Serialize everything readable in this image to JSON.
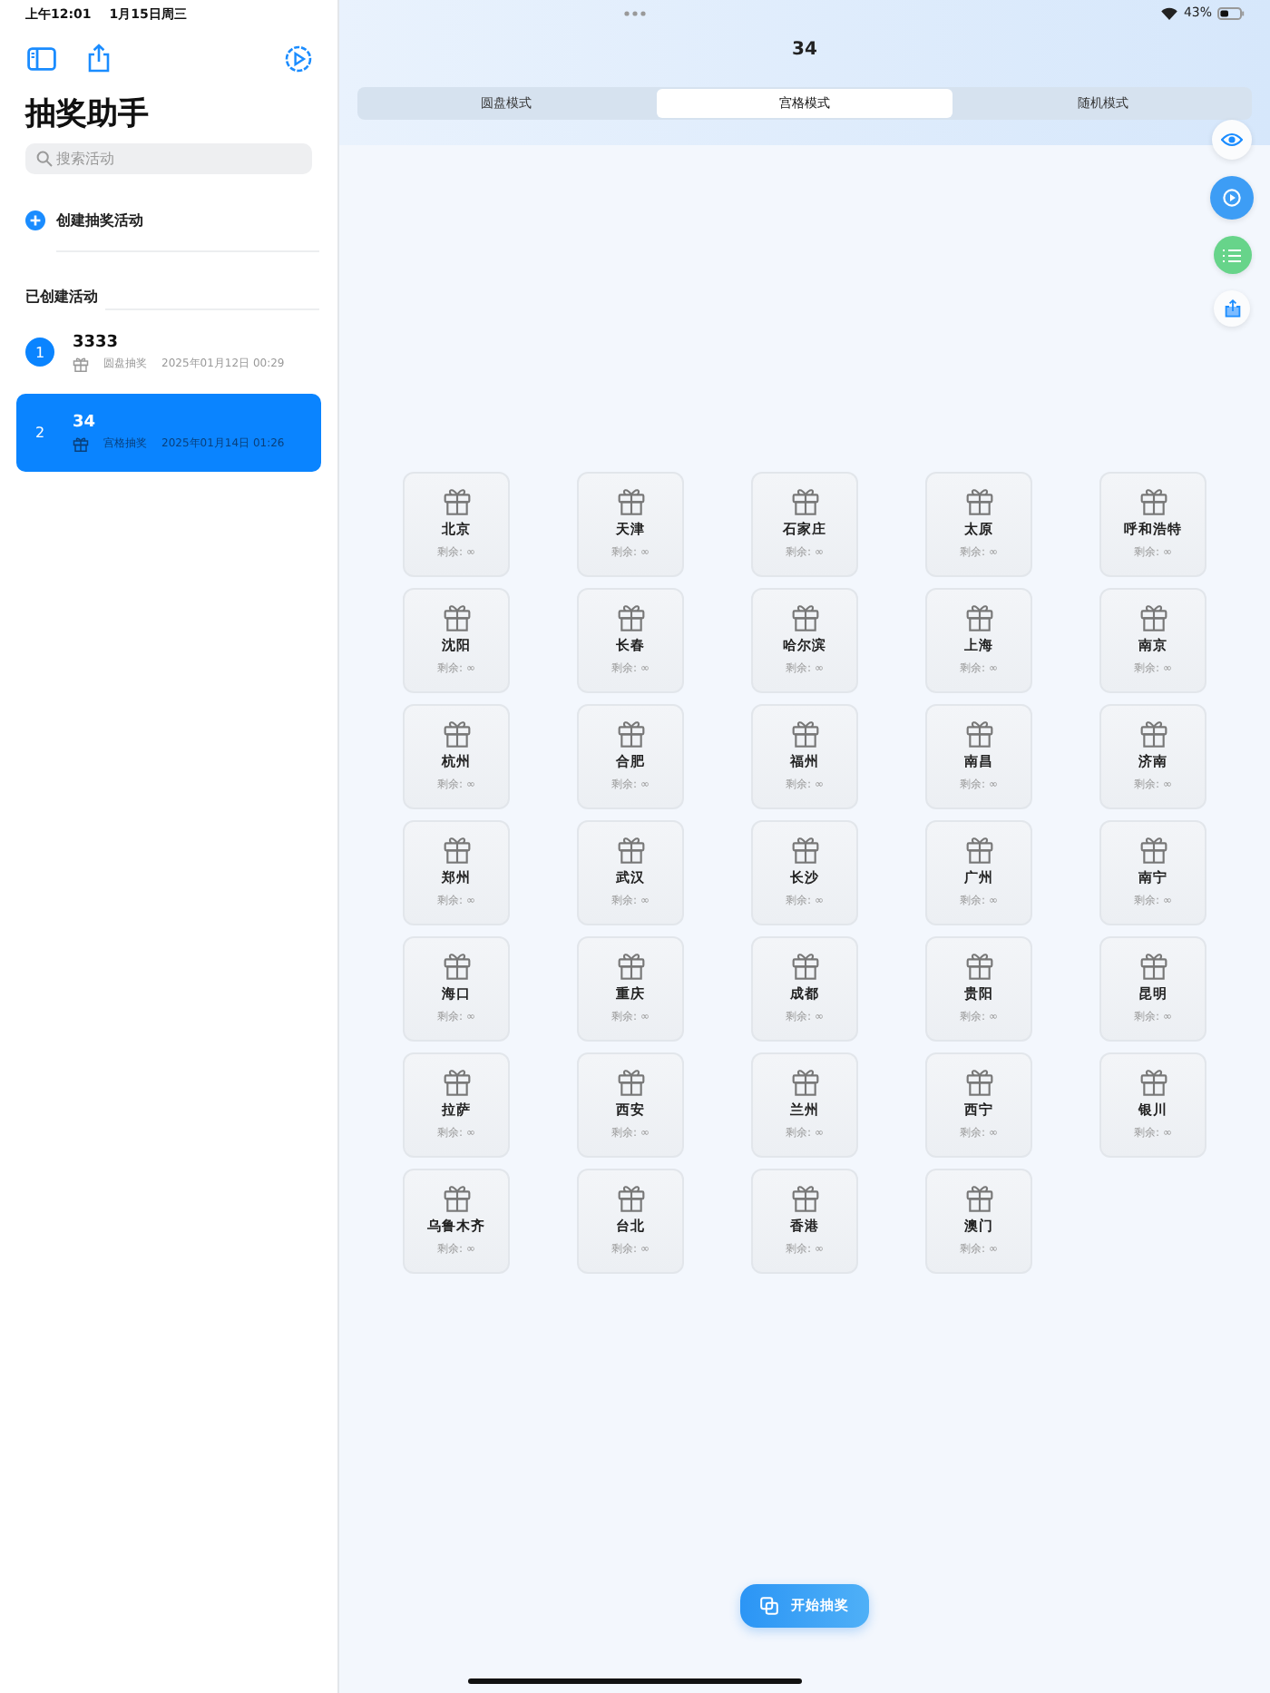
{
  "status_bar": {
    "time": "上午12:01",
    "date": "1月15日周三",
    "battery_text": "43%"
  },
  "sidebar": {
    "title": "抽奖助手",
    "search": {
      "placeholder": "搜索活动"
    },
    "create_label": "创建抽奖活动",
    "section_title": "已创建活动",
    "activities": [
      {
        "index": "1",
        "name": "3333",
        "type": "圆盘抽奖",
        "date": "2025年01月12日 00:29",
        "selected": false
      },
      {
        "index": "2",
        "name": "34",
        "type": "宫格抽奖",
        "date": "2025年01月14日 01:26",
        "selected": true
      }
    ]
  },
  "main": {
    "title": "34",
    "tabs": [
      {
        "label": "圆盘模式",
        "selected": false
      },
      {
        "label": "宫格模式",
        "selected": true
      },
      {
        "label": "随机模式",
        "selected": false
      }
    ],
    "prizes": [
      {
        "name": "北京",
        "remaining": "剩余: ∞"
      },
      {
        "name": "天津",
        "remaining": "剩余: ∞"
      },
      {
        "name": "石家庄",
        "remaining": "剩余: ∞"
      },
      {
        "name": "太原",
        "remaining": "剩余: ∞"
      },
      {
        "name": "呼和浩特",
        "remaining": "剩余: ∞"
      },
      {
        "name": "沈阳",
        "remaining": "剩余: ∞"
      },
      {
        "name": "长春",
        "remaining": "剩余: ∞"
      },
      {
        "name": "哈尔滨",
        "remaining": "剩余: ∞"
      },
      {
        "name": "上海",
        "remaining": "剩余: ∞"
      },
      {
        "name": "南京",
        "remaining": "剩余: ∞"
      },
      {
        "name": "杭州",
        "remaining": "剩余: ∞"
      },
      {
        "name": "合肥",
        "remaining": "剩余: ∞"
      },
      {
        "name": "福州",
        "remaining": "剩余: ∞"
      },
      {
        "name": "南昌",
        "remaining": "剩余: ∞"
      },
      {
        "name": "济南",
        "remaining": "剩余: ∞"
      },
      {
        "name": "郑州",
        "remaining": "剩余: ∞"
      },
      {
        "name": "武汉",
        "remaining": "剩余: ∞"
      },
      {
        "name": "长沙",
        "remaining": "剩余: ∞"
      },
      {
        "name": "广州",
        "remaining": "剩余: ∞"
      },
      {
        "name": "南宁",
        "remaining": "剩余: ∞"
      },
      {
        "name": "海口",
        "remaining": "剩余: ∞"
      },
      {
        "name": "重庆",
        "remaining": "剩余: ∞"
      },
      {
        "name": "成都",
        "remaining": "剩余: ∞"
      },
      {
        "name": "贵阳",
        "remaining": "剩余: ∞"
      },
      {
        "name": "昆明",
        "remaining": "剩余: ∞"
      },
      {
        "name": "拉萨",
        "remaining": "剩余: ∞"
      },
      {
        "name": "西安",
        "remaining": "剩余: ∞"
      },
      {
        "name": "兰州",
        "remaining": "剩余: ∞"
      },
      {
        "name": "西宁",
        "remaining": "剩余: ∞"
      },
      {
        "name": "银川",
        "remaining": "剩余: ∞"
      },
      {
        "name": "乌鲁木齐",
        "remaining": "剩余: ∞"
      },
      {
        "name": "台北",
        "remaining": "剩余: ∞"
      },
      {
        "name": "香港",
        "remaining": "剩余: ∞"
      },
      {
        "name": "澳门",
        "remaining": "剩余: ∞"
      }
    ],
    "start_button": "开始抽奖"
  }
}
